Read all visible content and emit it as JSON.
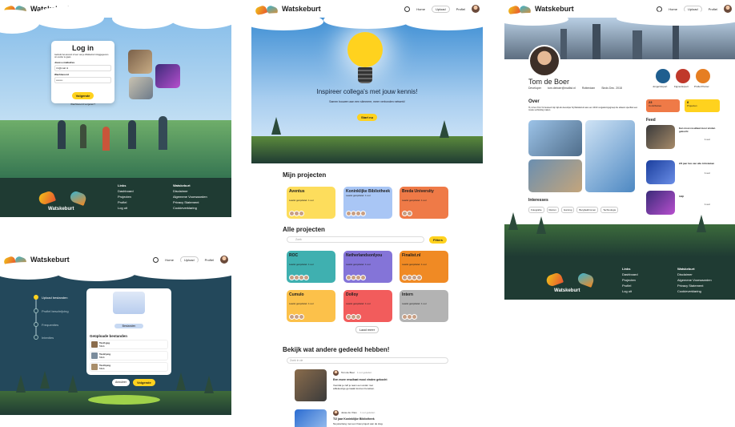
{
  "brand": {
    "name": "Watskeburt",
    "footer_name": "Watskeburt"
  },
  "colors": {
    "yellow": "#ffd21e",
    "sky": "#7fb9e8",
    "dark_green": "#1f3b33"
  },
  "nav": {
    "home": "Home",
    "upload": "Upload",
    "profile": "Profiel"
  },
  "login": {
    "title": "Log in",
    "intro": "Gebruik het account of een van je Watskeburt inloggegevens om verder te gaan.",
    "email_label": "Jouw e-mailadres",
    "email_value": "t.b@mail.nl",
    "password_label": "Wachtwoord",
    "password_value": "••••••••",
    "submit": "Volgende",
    "forgot": "Wachtwoord vergeten?"
  },
  "footer": {
    "col1_head": "Links",
    "col1": [
      "Dashboard",
      "Projecten",
      "Profiel",
      "Log uit"
    ],
    "col2_head": "Watskeburt",
    "col2": [
      "Disclaimer",
      "Algemene Voorwaarden",
      "Privacy Statement",
      "Cookieverklaring"
    ]
  },
  "upload": {
    "steps": [
      "Upload bestanden",
      "Profiel beschrijving",
      "Frequenties",
      "Intenties"
    ],
    "button": "Bestanden",
    "list_title": "Geüploade bestanden",
    "files": [
      {
        "name": "Test1.jpg",
        "size": "53kb"
      },
      {
        "name": "Test2.png",
        "size": "53kb"
      },
      {
        "name": "Test3.png",
        "size": "53kb"
      }
    ],
    "cancel": "Annuleer",
    "next": "Volgende"
  },
  "hero": {
    "title": "Inspireer collega's met jouw kennis!",
    "subtitle": "Samen bouwen aan een slimmere, meer verbonden netwerk!",
    "button": "Start nu"
  },
  "projects": {
    "mine_title": "Mijn projecten",
    "mine": [
      {
        "name": "Aventus",
        "sub": "Laatst geüpdatet: 1 uur",
        "color": "#fddd5c"
      },
      {
        "name": "Koninklijke Bibliotheek",
        "sub": "Laatst geüpdatet: 1 uur",
        "color": "#a9c6f5"
      },
      {
        "name": "Breda University",
        "sub": "Laatst geüpdatet: 1 uur",
        "color": "#ef7a47"
      }
    ],
    "all_title": "Alle projecten",
    "search_placeholder": "Zoek",
    "filter": "Filters",
    "all": [
      {
        "name": "ROC",
        "sub": "Laatst geüpdatet: 1 uur",
        "color": "#3fb0b0"
      },
      {
        "name": "Netherlandsonlyou",
        "sub": "Laatst geüpdatet: 1 uur",
        "color": "#8474d8"
      },
      {
        "name": "Finalist.nl",
        "sub": "Laatst geüpdatet: 1 uur",
        "color": "#f08a24"
      },
      {
        "name": "Cumulo",
        "sub": "Laatst geüpdatet: 1 uur",
        "color": "#fcc14a"
      },
      {
        "name": "Dolloy",
        "sub": "Laatst geüpdatet: 1 uur",
        "color": "#f25c5c"
      },
      {
        "name": "Intern",
        "sub": "Laatst geüpdatet: 1 uur",
        "color": "#b3b3b3"
      }
    ],
    "load_more": "Laad meer"
  },
  "shared": {
    "title": "Bekijk wat andere gedeeld hebben!",
    "search_placeholder": "Zoek in de",
    "posts": [
      {
        "author": "Tom de Boer",
        "time": "1 uur geleden",
        "title": "Een more resultaat mooi vinden gekocht",
        "body": "Voordat je zelf je team een ander met willekeurige gemaakt kunnen bereiken."
      },
      {
        "author": "Jesse de Vries",
        "time": "1 uur geleden",
        "title": "Tl2 jaar Koninklijke Bibliotheek",
        "body": "Na jarenlang met een fraai project aan de slag."
      }
    ]
  },
  "profile": {
    "name": "Tom de Boer",
    "role": "Developer",
    "email": "tom.deboer@mailist.nl",
    "city": "Rotterdam",
    "since": "Sinds Dec. 2018",
    "badges": [
      "Jongel Expert",
      "Figma Expert",
      "Profiel Pionier"
    ],
    "about_title": "Over",
    "about": "Hi, ik ben Tom! Ik besteed mijn tijd als developer bij Watskeburt aan een 10/10 vergaderingsgroep die elkaars specifiek een mooie verbinding maken.",
    "stat1_value": "23",
    "stat1_label": "Contributies",
    "stat2_value": "8",
    "stat2_label": "Projecten",
    "interests_title": "Interesses",
    "interests": [
      "Fotografie",
      "Reizen",
      "Gaming",
      "Bergbeklimmen",
      "Technologie"
    ],
    "feed_title": "Feed",
    "feed": [
      {
        "title": "Een mooi resultaat mooi vinden gekocht",
        "time": "1 uur"
      },
      {
        "title": "2/3 jaar live van alle Artistieken",
        "time": "1 uur"
      },
      {
        "title": "Inlijt",
        "time": "1 uur"
      }
    ]
  }
}
